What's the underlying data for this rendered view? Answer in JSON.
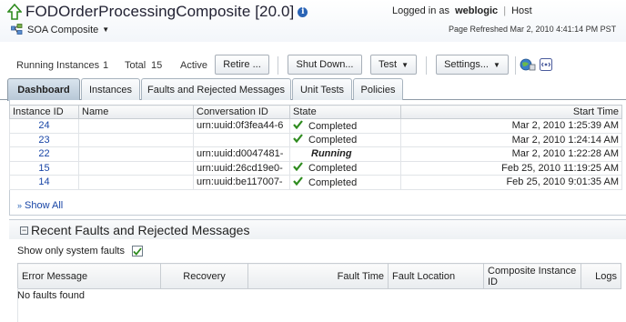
{
  "header": {
    "title": "FODOrderProcessingComposite [20.0]",
    "login_prefix": "Logged in as",
    "user": "weblogic",
    "host_link": "Host",
    "composite_menu": "SOA Composite",
    "page_refreshed": "Page Refreshed Mar 2, 2010 4:41:14 PM PST"
  },
  "toolbar": {
    "running_label": "Running Instances",
    "running_count": "1",
    "total_label": "Total",
    "total_count": "15",
    "active_label": "Active",
    "retire_button": "Retire ...",
    "shutdown_button": "Shut Down...",
    "test_button": "Test",
    "settings_button": "Settings..."
  },
  "tabs": [
    {
      "label": "Dashboard",
      "active": true
    },
    {
      "label": "Instances",
      "active": false
    },
    {
      "label": "Faults and Rejected Messages",
      "active": false
    },
    {
      "label": "Unit Tests",
      "active": false
    },
    {
      "label": "Policies",
      "active": false
    }
  ],
  "instances": {
    "columns": [
      "Instance ID",
      "Name",
      "Conversation ID",
      "State",
      "Start Time"
    ],
    "rows": [
      {
        "id": "24",
        "name": "",
        "conv": "urn:uuid:0f3fea44-6",
        "state": "Completed",
        "start": "Mar 2, 2010 1:25:39 AM"
      },
      {
        "id": "23",
        "name": "",
        "conv": "",
        "state": "Completed",
        "start": "Mar 2, 2010 1:24:14 AM"
      },
      {
        "id": "22",
        "name": "",
        "conv": "urn:uuid:d0047481-",
        "state": "Running",
        "start": "Mar 2, 2010 1:22:28 AM"
      },
      {
        "id": "15",
        "name": "",
        "conv": "urn:uuid:26cd19e0-",
        "state": "Completed",
        "start": "Feb 25, 2010 11:19:25 AM"
      },
      {
        "id": "14",
        "name": "",
        "conv": "urn:uuid:be117007-",
        "state": "Completed",
        "start": "Feb 25, 2010 9:01:35 AM"
      }
    ],
    "show_all": "Show All"
  },
  "faults": {
    "title": "Recent Faults and Rejected Messages",
    "system_only_label": "Show only system faults",
    "system_only_checked": true,
    "columns": {
      "error": "Error Message",
      "recovery": "Recovery",
      "fault_time": "Fault Time",
      "fault_location": "Fault Location",
      "composite_instance_id": "Composite Instance ID",
      "logs": "Logs"
    },
    "empty_text": "No faults found"
  },
  "colors": {
    "link": "#1845a6",
    "check_green": "#2e8b1e",
    "active_tab": "#b6c6d6"
  }
}
